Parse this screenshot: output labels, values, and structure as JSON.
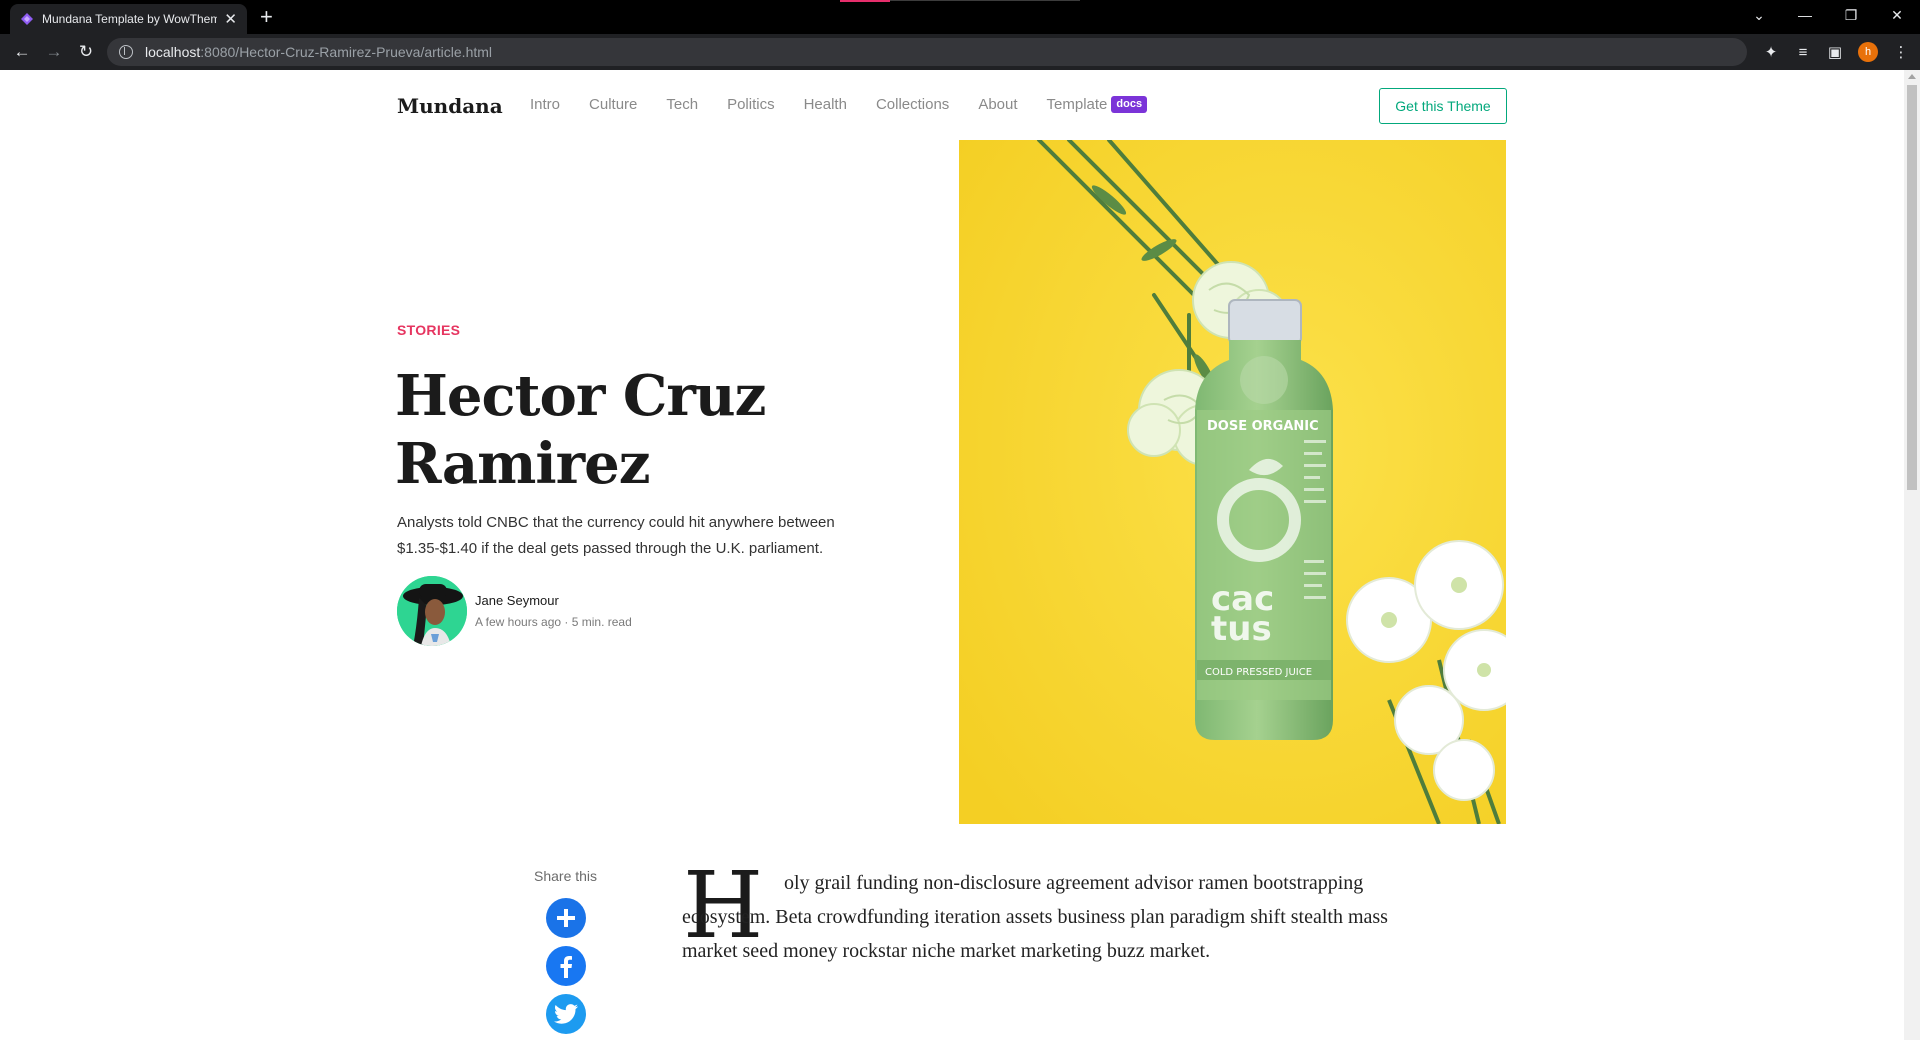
{
  "browser": {
    "tab_title": "Mundana Template by WowThemes",
    "new_tab": "+",
    "url_host": "localhost",
    "url_path": ":8080/Hector-Cruz-Ramirez-Prueva/article.html",
    "profile_initial": "h"
  },
  "site": {
    "brand": "Mundana",
    "nav": [
      "Intro",
      "Culture",
      "Tech",
      "Politics",
      "Health",
      "Collections",
      "About"
    ],
    "nav_template": "Template",
    "nav_badge": "docs",
    "cta": "Get this Theme"
  },
  "hero": {
    "category": "STORIES",
    "title": "Hector Cruz Ramirez",
    "lead": "Analysts told CNBC that the currency could hit anywhere between $1.35-$1.40 if the deal gets passed through the U.K. parliament.",
    "author": "Jane Seymour",
    "meta": "A few hours ago · 5 min. read",
    "image": {
      "bottle_brand": "DOSE ORGANIC",
      "bottle_text_1": "cac",
      "bottle_text_2": "tus",
      "bottle_band": "COLD PRESSED JUICE"
    }
  },
  "article": {
    "share_label": "Share this",
    "dropcap": "H",
    "paragraph": "oly grail funding non-disclosure agreement advisor ramen bootstrapping ecosystem. Beta crowdfunding iteration assets business plan paradigm shift stealth mass market seed money rockstar niche market marketing buzz market."
  },
  "colors": {
    "accent_green": "#03a87c",
    "category_red": "#e63560",
    "badge_purple": "#7b34d8",
    "hero_bg_yellow": "#f8d733"
  },
  "icons": [
    "back-icon",
    "forward-icon",
    "reload-icon",
    "site-info-icon",
    "extensions-icon",
    "media-icon",
    "sidepanel-icon",
    "menu-icon",
    "share-plus-icon",
    "facebook-icon",
    "twitter-icon"
  ]
}
